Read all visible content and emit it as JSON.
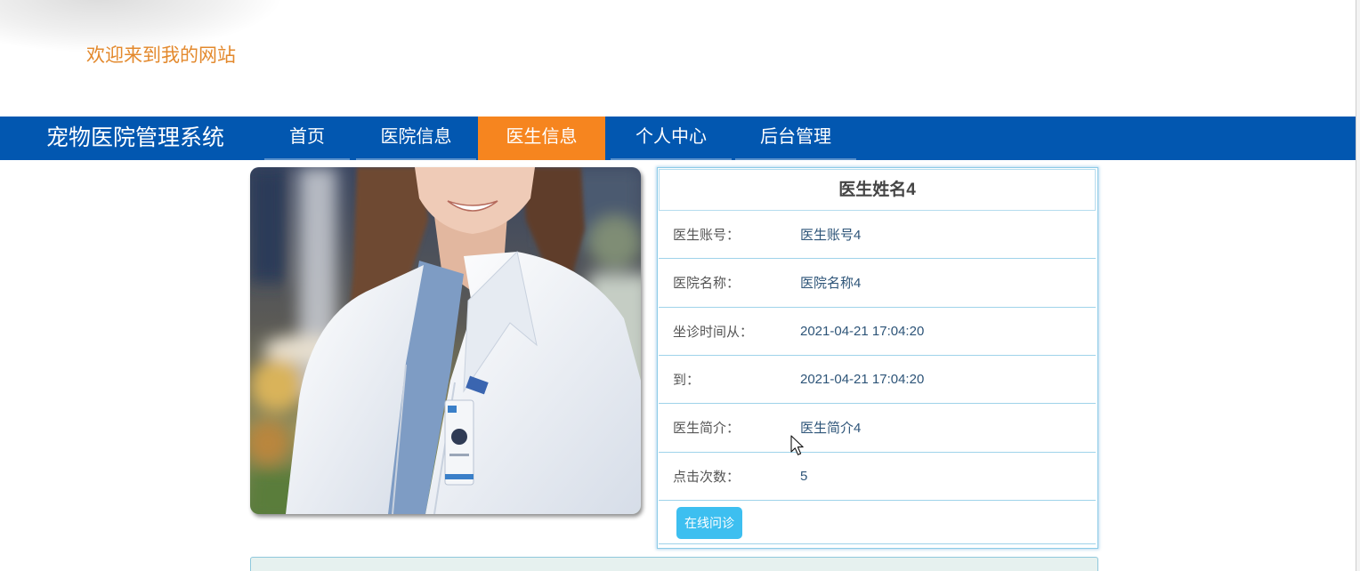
{
  "header": {
    "welcome": "欢迎来到我的网站"
  },
  "nav": {
    "brand": "宠物医院管理系统",
    "items": [
      {
        "label": "首页",
        "active": false
      },
      {
        "label": "医院信息",
        "active": false
      },
      {
        "label": "医生信息",
        "active": true
      },
      {
        "label": "个人中心",
        "active": false
      },
      {
        "label": "后台管理",
        "active": false
      }
    ]
  },
  "doctor": {
    "name": "医生姓名4",
    "fields": [
      {
        "label": "医生账号：",
        "value": "医生账号4"
      },
      {
        "label": "医院名称：",
        "value": "医院名称4"
      },
      {
        "label": "坐诊时间从：",
        "value": "2021-04-21 17:04:20"
      },
      {
        "label": "到：",
        "value": "2021-04-21 17:04:20"
      },
      {
        "label": "医生简介：",
        "value": "医生简介4"
      },
      {
        "label": "点击次数：",
        "value": "5"
      }
    ],
    "consult_button": "在线问诊"
  },
  "colors": {
    "nav_bg": "#0257b0",
    "nav_active_bg": "#f6851f",
    "welcome_text": "#e3892d",
    "panel_border": "#8ccbe7",
    "button_bg": "#3dbff0",
    "label_text": "#555555",
    "value_text": "#2d5478"
  }
}
